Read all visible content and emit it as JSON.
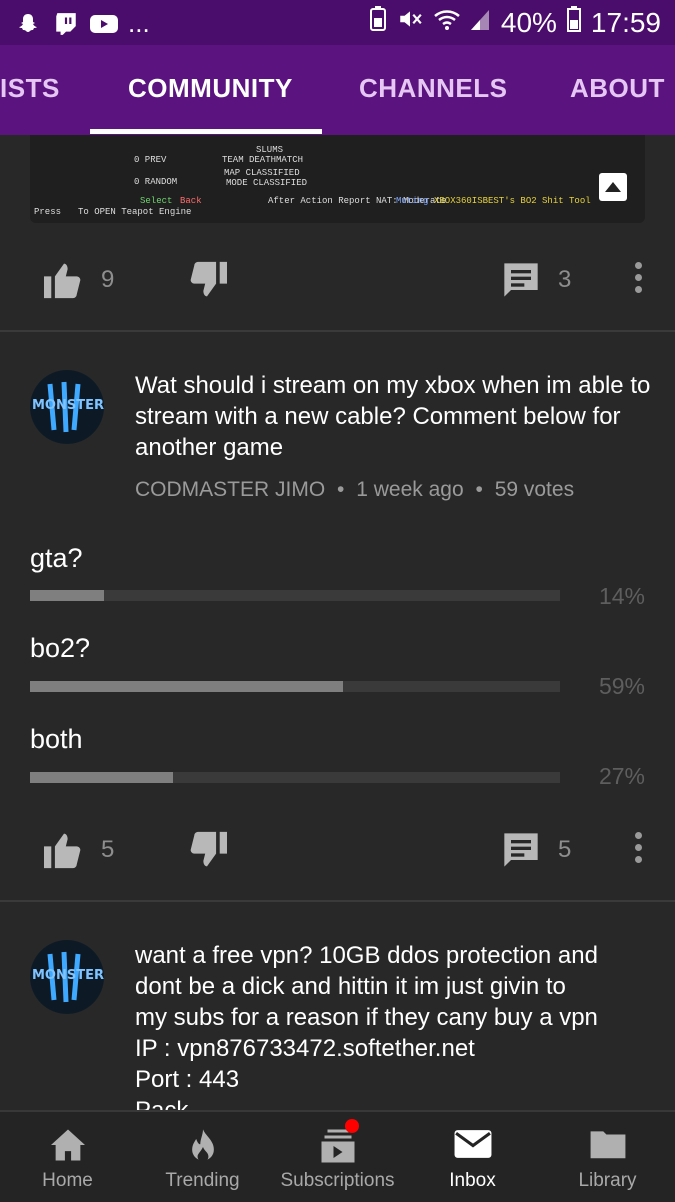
{
  "status": {
    "battery": "40%",
    "time": "17:59",
    "dots": "..."
  },
  "tabs": [
    {
      "label": "ISTS"
    },
    {
      "label": "COMMUNITY"
    },
    {
      "label": "CHANNELS"
    },
    {
      "label": "ABOUT"
    }
  ],
  "thumb": {
    "lines": [
      "0 PREV",
      "SLUMS",
      "TEAM DEATHMATCH",
      "0 RANDOM",
      "MAP CLASSIFIED",
      "MODE CLASSIFIED",
      "Select",
      "Back",
      "After Action Report  NAT: Moderate",
      "Muting",
      "XBOX360ISBEST's BO2 Shit Tool",
      "Press",
      "To OPEN Teapot Engine"
    ]
  },
  "post1": {
    "likes": "9",
    "comments": "3"
  },
  "post2": {
    "avatar_text": "MONSTER",
    "text": "Wat should i stream on my xbox when im able to stream with a new cable? Comment below for another game",
    "author": "CODMASTER JIMO",
    "sep": "•",
    "time": "1 week ago",
    "votes": "59 votes",
    "options": [
      {
        "label": "gta?",
        "pct": "14%",
        "value": 14
      },
      {
        "label": "bo2?",
        "pct": "59%",
        "value": 59
      },
      {
        "label": "both",
        "pct": "27%",
        "value": 27
      }
    ],
    "likes": "5",
    "comments": "5"
  },
  "post3": {
    "avatar_text": "MONSTER",
    "lines": [
      "want a free vpn? 10GB ddos protection and",
      "dont be a dick and hittin it im  just givin to",
      "my subs for a reason if they cany buy a vpn",
      "IP : vpn876733472.softether.net",
      "Port : 443",
      "Pack"
    ]
  },
  "bottomnav": [
    {
      "label": "Home",
      "icon": "home-icon"
    },
    {
      "label": "Trending",
      "icon": "flame-icon"
    },
    {
      "label": "Subscriptions",
      "icon": "subscriptions-icon"
    },
    {
      "label": "Inbox",
      "icon": "mail-icon"
    },
    {
      "label": "Library",
      "icon": "folder-icon"
    }
  ]
}
